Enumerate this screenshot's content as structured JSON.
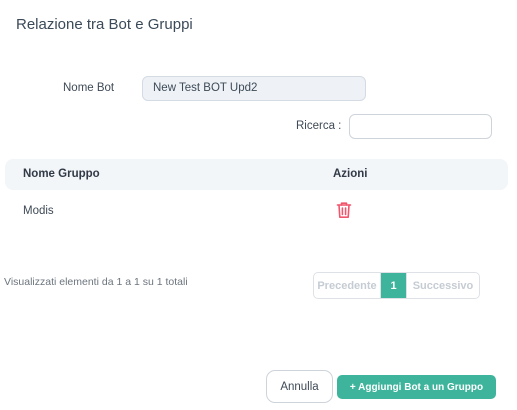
{
  "page": {
    "title": "Relazione tra Bot e Gruppi"
  },
  "form": {
    "bot_label": "Nome Bot",
    "bot_value": "New Test BOT Upd2",
    "search_label": "Ricerca :",
    "search_value": ""
  },
  "table": {
    "headers": [
      "Nome Gruppo",
      "Azioni"
    ],
    "rows": [
      {
        "name": "Modis",
        "action_icon": "trash-icon"
      }
    ]
  },
  "footer": {
    "info": "Visualizzati elementi da 1 a 1 su 1 totali",
    "pagination": {
      "previous": "Precedente",
      "current": "1",
      "next": "Successivo"
    }
  },
  "actions": {
    "cancel": "Annulla",
    "add": "+ Aggiungi Bot a un Gruppo"
  },
  "colors": {
    "accent": "#3fb49c",
    "danger": "#f1556c"
  }
}
